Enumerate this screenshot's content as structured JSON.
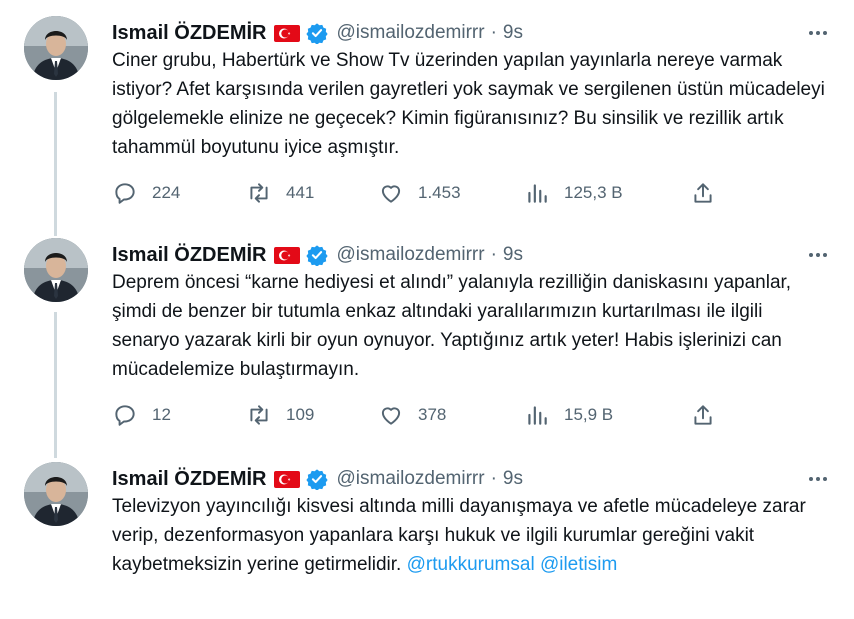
{
  "tweets": [
    {
      "author_name": "Ismail ÖZDEMİR",
      "handle": "@ismailozdemirrr",
      "separator": "·",
      "time": "9s",
      "text": "Ciner grubu, Habertürk ve Show Tv üzerinden yapılan yayınlarla nereye varmak istiyor? Afet karşısında verilen gayretleri yok saymak ve sergilenen üstün mücadeleyi gölgelemekle elinize ne geçecek? Kimin figüranısınız? Bu sinsilik ve rezillik artık tahammül boyutunu iyice aşmıştır.",
      "replies": "224",
      "retweets": "441",
      "likes": "1.453",
      "views": "125,3 B"
    },
    {
      "author_name": "Ismail ÖZDEMİR",
      "handle": "@ismailozdemirrr",
      "separator": "·",
      "time": "9s",
      "text": "Deprem öncesi “karne hediyesi et alındı” yalanıyla rezilliğin daniskasını yapanlar, şimdi de benzer bir tutumla enkaz altındaki yaralılarımızın kurtarılması ile ilgili senaryo yazarak kirli bir oyun oynuyor. Yaptığınız artık yeter! Habis işlerinizi can mücadelemize bulaştırmayın.",
      "replies": "12",
      "retweets": "109",
      "likes": "378",
      "views": "15,9 B"
    },
    {
      "author_name": "Ismail ÖZDEMİR",
      "handle": "@ismailozdemirrr",
      "separator": "·",
      "time": "9s",
      "text": "Televizyon yayıncılığı kisvesi altında milli dayanışmaya ve afetle mücadeleye zarar verip, dezenformasyon yapanlara karşı hukuk ve ilgili kurumlar gereğini vakit kaybetmeksizin yerine getirmelidir.",
      "mentions": [
        "@rtukkurumsal",
        "@iletisim"
      ]
    }
  ],
  "icons": {
    "more": "more-icon",
    "reply": "reply-icon",
    "retweet": "retweet-icon",
    "like": "heart-icon",
    "views": "views-icon",
    "share": "share-icon",
    "verified": "verified-badge-icon",
    "flag": "turkey-flag-icon"
  },
  "colors": {
    "text": "#0f1419",
    "secondary": "#536471",
    "link": "#1d9bf0",
    "verified": "#1d9bf0",
    "flag": "#e30a17",
    "thread_line": "#cfd9de"
  }
}
